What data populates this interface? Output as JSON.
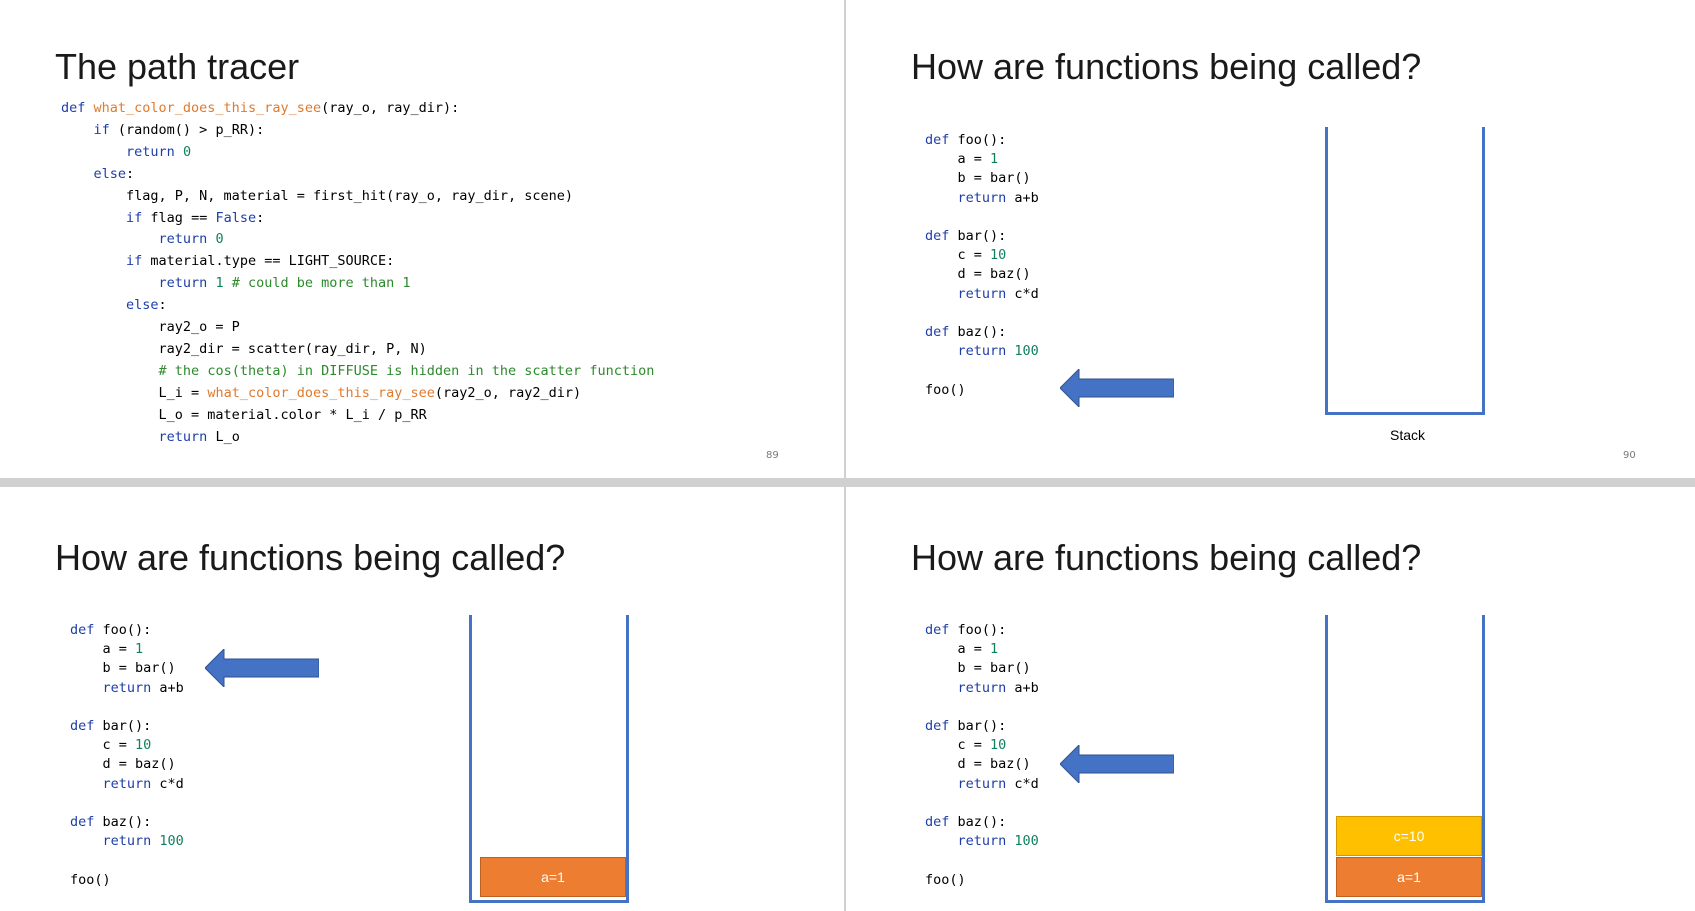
{
  "slide89": {
    "title": "The path tracer",
    "page": "89",
    "code": [
      [
        [
          "kw",
          "def "
        ],
        [
          "fn",
          "what_color_does_this_ray_see"
        ],
        [
          "",
          "(ray_o, ray_dir):"
        ]
      ],
      [
        [
          "",
          "    "
        ],
        [
          "kw",
          "if"
        ],
        [
          "",
          " (random() > p_RR):"
        ]
      ],
      [
        [
          "",
          "        "
        ],
        [
          "kw",
          "return "
        ],
        [
          "num",
          "0"
        ]
      ],
      [
        [
          "",
          "    "
        ],
        [
          "kw",
          "else"
        ],
        [
          "",
          ":"
        ]
      ],
      [
        [
          "",
          "        flag, P, N, material = first_hit(ray_o, ray_dir, scene)"
        ]
      ],
      [
        [
          "",
          "        "
        ],
        [
          "kw",
          "if"
        ],
        [
          "",
          " flag == "
        ],
        [
          "kw",
          "False"
        ],
        [
          "",
          ":"
        ]
      ],
      [
        [
          "",
          "            "
        ],
        [
          "kw",
          "return "
        ],
        [
          "num",
          "0"
        ]
      ],
      [
        [
          "",
          "        "
        ],
        [
          "kw",
          "if"
        ],
        [
          "",
          " material.type == LIGHT_SOURCE:"
        ]
      ],
      [
        [
          "",
          "            "
        ],
        [
          "kw",
          "return "
        ],
        [
          "num",
          "1 "
        ],
        [
          "cm",
          "# could be more than 1"
        ]
      ],
      [
        [
          "",
          "        "
        ],
        [
          "kw",
          "else"
        ],
        [
          "",
          ":"
        ]
      ],
      [
        [
          "",
          "            ray2_o = P"
        ]
      ],
      [
        [
          "",
          "            ray2_dir = scatter(ray_dir, P, N)"
        ]
      ],
      [
        [
          "",
          "            "
        ],
        [
          "cm",
          "# the cos(theta) in DIFFUSE is hidden in the scatter function"
        ]
      ],
      [
        [
          "",
          "            L_i = "
        ],
        [
          "fn",
          "what_color_does_this_ray_see"
        ],
        [
          "",
          "(ray2_o, ray2_dir)"
        ]
      ],
      [
        [
          "",
          "            L_o = material.color * L_i / p_RR"
        ]
      ],
      [
        [
          "",
          "            "
        ],
        [
          "kw",
          "return"
        ],
        [
          "",
          " L_o"
        ]
      ]
    ]
  },
  "calls_title": "How are functions being called?",
  "calls_code": [
    [
      [
        "kw",
        "def "
      ],
      [
        "",
        "foo():"
      ]
    ],
    [
      [
        "",
        "    a = "
      ],
      [
        "num",
        "1"
      ]
    ],
    [
      [
        "",
        "    b = bar()"
      ]
    ],
    [
      [
        "",
        "    "
      ],
      [
        "kw",
        "return"
      ],
      [
        "",
        " a+b"
      ]
    ],
    [
      [
        "",
        ""
      ]
    ],
    [
      [
        "kw",
        "def "
      ],
      [
        "",
        "bar():"
      ]
    ],
    [
      [
        "",
        "    c = "
      ],
      [
        "num",
        "10"
      ]
    ],
    [
      [
        "",
        "    d = baz()"
      ]
    ],
    [
      [
        "",
        "    "
      ],
      [
        "kw",
        "return"
      ],
      [
        "",
        " c*d"
      ]
    ],
    [
      [
        "",
        ""
      ]
    ],
    [
      [
        "kw",
        "def "
      ],
      [
        "",
        "baz():"
      ]
    ],
    [
      [
        "",
        "    "
      ],
      [
        "kw",
        "return "
      ],
      [
        "num",
        "100"
      ]
    ],
    [
      [
        "",
        ""
      ]
    ],
    [
      [
        "",
        "foo()"
      ]
    ]
  ],
  "slide90": {
    "page": "90",
    "stack_label": "Stack",
    "frames": []
  },
  "slide91": {
    "frames": [
      "a=1"
    ]
  },
  "slide92": {
    "frames": [
      "a=1",
      "c=10"
    ]
  },
  "colors": {
    "keyword": "#1d3ea8",
    "number": "#118060",
    "function": "#e07a2e",
    "comment": "#2d8a2d",
    "stack_border": "#4472c4",
    "arrow": "#4472c4",
    "frame_a": "#ed7d31",
    "frame_c": "#ffc000"
  },
  "icons": {
    "pointer": "left-arrow-icon"
  }
}
